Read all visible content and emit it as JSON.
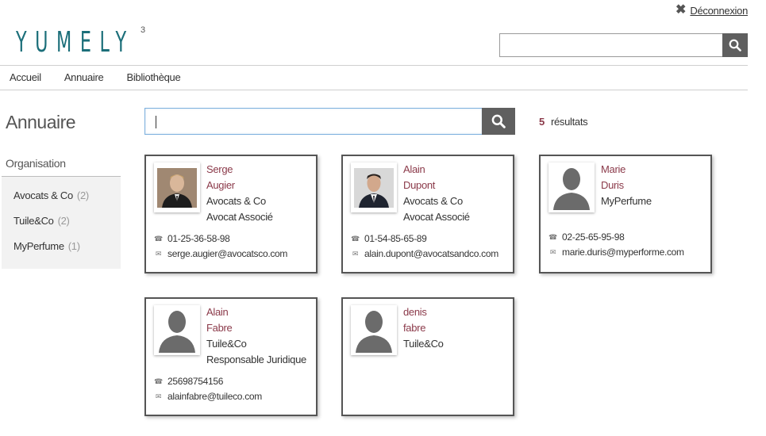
{
  "header": {
    "logout_label": "Déconnexion",
    "logo_text": "YUMELY",
    "logo_version": "3",
    "search_value": ""
  },
  "nav": {
    "items": [
      "Accueil",
      "Annuaire",
      "Bibliothèque"
    ]
  },
  "sidebar": {
    "title": "Annuaire",
    "filter_title": "Organisation",
    "orgs": [
      {
        "label": "Avocats & Co",
        "count": "(2)"
      },
      {
        "label": "Tuile&Co",
        "count": "(2)"
      },
      {
        "label": "MyPerfume",
        "count": "(1)"
      }
    ]
  },
  "search": {
    "value": "",
    "results_count": "5",
    "results_label": "résultats"
  },
  "cards": [
    {
      "first": "Serge",
      "last": "Augier",
      "org": "Avocats & Co",
      "role": "Avocat Associé",
      "phone": "01-25-36-58-98",
      "email": "serge.augier@avocatsco.com",
      "photo": "man-photo-1"
    },
    {
      "first": "Alain",
      "last": "Dupont",
      "org": "Avocats & Co",
      "role": "Avocat Associé",
      "phone": "01-54-85-65-89",
      "email": "alain.dupont@avocatsandco.com",
      "photo": "man-photo-2"
    },
    {
      "first": "Marie",
      "last": "Duris",
      "org": "MyPerfume",
      "role": "",
      "phone": "02-25-65-95-98",
      "email": "marie.duris@myperforme.com",
      "photo": "avatar-placeholder"
    },
    {
      "first": "Alain",
      "last": "Fabre",
      "org": "Tuile&Co",
      "role": "Responsable Juridique",
      "phone": "25698754156",
      "email": "alainfabre@tuileco.com",
      "photo": "avatar-placeholder"
    },
    {
      "first": "denis",
      "last": "fabre",
      "org": "Tuile&Co",
      "role": "",
      "phone": "",
      "email": "",
      "photo": "avatar-placeholder"
    }
  ],
  "colors": {
    "brand": "#1c6f7a",
    "name_accent": "#8b3a4a",
    "button_bg": "#5f5f5f"
  }
}
